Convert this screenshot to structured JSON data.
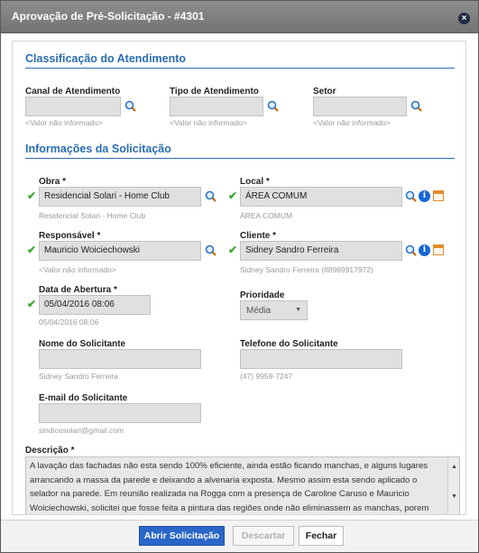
{
  "dialog": {
    "title": "Aprovação de Pré-Solicitação - #4301",
    "close_symbol": "×"
  },
  "classificacao": {
    "heading": "Classificação do Atendimento",
    "canal": {
      "label": "Canal de Atendimento",
      "value": "",
      "hint": "<Valor não informado>"
    },
    "tipo": {
      "label": "Tipo de Atendimento",
      "value": "",
      "hint": "<Valor não informado>"
    },
    "setor": {
      "label": "Setor",
      "value": "",
      "hint": "<Valor não informado>"
    }
  },
  "informacoes": {
    "heading": "Informações da Solicitação",
    "obra": {
      "label": "Obra *",
      "value": "Residencial Solari - Home Club",
      "hint": "Residencial Solari - Home Club"
    },
    "local": {
      "label": "Local *",
      "value": "ÁREA COMUM",
      "hint": "ÁREA COMUM"
    },
    "responsavel": {
      "label": "Responsável *",
      "value": "Mauricio Woiciechowski",
      "hint": "<Valor não informado>"
    },
    "cliente": {
      "label": "Cliente *",
      "value": "Sidney Sandro Ferreira",
      "hint": "Sidney Sandro Ferreira (88989917972)"
    },
    "data_abertura": {
      "label": "Data de Abertura *",
      "value": "05/04/2016 08:06",
      "hint": "05/04/2016 08:06"
    },
    "prioridade": {
      "label": "Prioridade",
      "value": "Média"
    },
    "nome_solicitante": {
      "label": "Nome do Solicitante",
      "value": "",
      "hint": "Sidney Sandro Ferreira"
    },
    "telefone_solicitante": {
      "label": "Telefone do Solicitante",
      "value": "",
      "hint": "(47) 9959-7247"
    },
    "email_solicitante": {
      "label": "E-mail do Solicitante",
      "value": "",
      "hint": "sindicosolari@gmail.com"
    }
  },
  "descricao": {
    "label": "Descrição *",
    "text": "A lavação das fachadas não esta sendo 100% eficiente, ainda estão ficando manchas, e alguns lugares arrancando a massa da parede e deixando a alvenaria exposta. Mesmo assim esta sendo aplicado o selador na parede. Em reunião realizada na Rogga com a presença de Caroline Caruso e Mauricio Woiciechowski, solicitei que fosse feita a pintura das regiões onde não eliminassem as manchas, porem"
  },
  "footer": {
    "abrir_label": "Abrir Solicitação",
    "descartar_label": "Descartar",
    "fechar_label": "Fechar"
  },
  "icons": {
    "check": "✔",
    "info": "i",
    "arrow_down": "▼",
    "arrow_up": "▲"
  }
}
